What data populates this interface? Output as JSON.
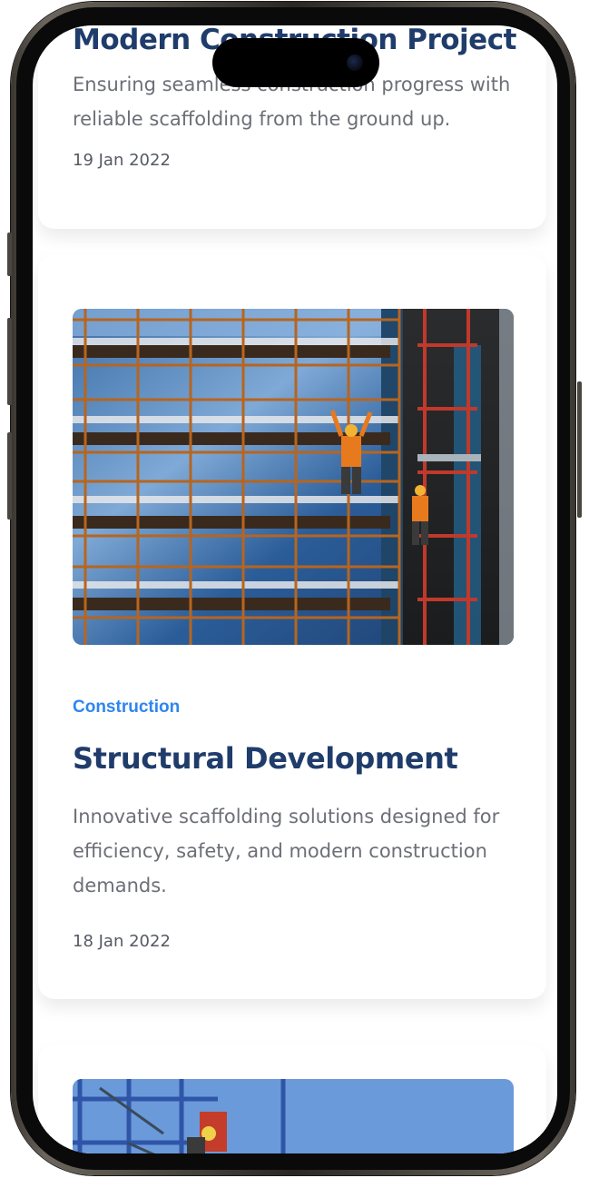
{
  "posts": [
    {
      "title": "Modern Construction Project",
      "description": "Ensuring seamless construction progress with reliable scaffolding from the ground up.",
      "date": "19 Jan 2022"
    },
    {
      "category": "Construction",
      "title": "Structural Development",
      "description": "Innovative scaffolding solutions designed for efficiency, safety, and modern construction demands.",
      "date": "18 Jan 2022"
    }
  ],
  "colors": {
    "heading": "#1f3c6b",
    "category": "#2e86f0",
    "body_text": "#6c6f76",
    "card_bg": "#ffffff"
  },
  "icons": {
    "front_camera": "camera-icon"
  }
}
